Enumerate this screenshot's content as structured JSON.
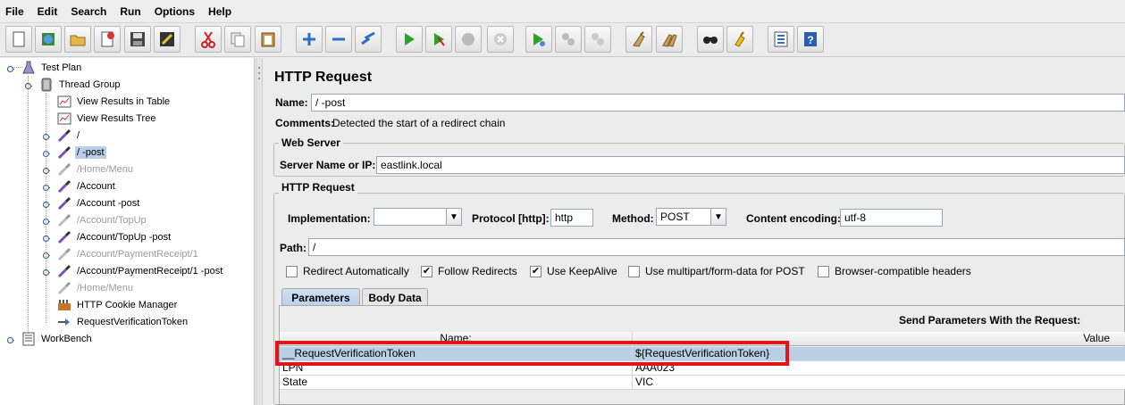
{
  "menu": [
    "File",
    "Edit",
    "Search",
    "Run",
    "Options",
    "Help"
  ],
  "toolbar": {
    "buttons": [
      "new-icon",
      "templates-icon",
      "open-icon",
      "close-icon",
      "save-icon",
      "save-as-icon",
      "cut-icon",
      "copy-icon",
      "paste-icon",
      "expand-icon",
      "collapse-icon",
      "toggle-icon",
      "start-icon",
      "start-no-pause-icon",
      "stop-icon",
      "shutdown-icon",
      "remote-start-icon",
      "remote-stop-icon",
      "remote-shutdown-icon",
      "clear-icon",
      "clear-all-icon",
      "search-icon",
      "reset-search-icon",
      "function-helper-icon",
      "help-icon"
    ]
  },
  "tree": {
    "items": [
      {
        "label": "Test Plan"
      },
      {
        "label": "Thread Group"
      },
      {
        "label": "View Results in Table"
      },
      {
        "label": "View Results Tree"
      },
      {
        "label": "/"
      },
      {
        "label": "/ -post"
      },
      {
        "label": "/Home/Menu"
      },
      {
        "label": "/Account"
      },
      {
        "label": "/Account -post"
      },
      {
        "label": "/Account/TopUp"
      },
      {
        "label": "/Account/TopUp -post"
      },
      {
        "label": "/Account/PaymentReceipt/1"
      },
      {
        "label": "/Account/PaymentReceipt/1 -post"
      },
      {
        "label": "/Home/Menu"
      },
      {
        "label": "HTTP Cookie Manager"
      },
      {
        "label": "RequestVerificationToken"
      },
      {
        "label": "WorkBench"
      }
    ]
  },
  "panel": {
    "title": "HTTP Request",
    "name_label": "Name:",
    "name_value": "/ -post",
    "comments_label": "Comments:",
    "comments_value": "Detected the start of a redirect chain",
    "web_server_legend": "Web Server",
    "server_label": "Server Name or IP:",
    "server_value": "eastlink.local",
    "http_request_legend": "HTTP Request",
    "implementation_label": "Implementation:",
    "implementation_value": "",
    "protocol_label": "Protocol [http]:",
    "protocol_value": "http",
    "method_label": "Method:",
    "method_value": "POST",
    "encoding_label": "Content encoding:",
    "encoding_value": "utf-8",
    "path_label": "Path:",
    "path_value": "/",
    "checkboxes": [
      {
        "label": "Redirect Automatically",
        "checked": false
      },
      {
        "label": "Follow Redirects",
        "checked": true
      },
      {
        "label": "Use KeepAlive",
        "checked": true
      },
      {
        "label": "Use multipart/form-data for POST",
        "checked": false
      },
      {
        "label": "Browser-compatible headers",
        "checked": false
      }
    ],
    "tabs": [
      "Parameters",
      "Body Data"
    ],
    "send_params_label": "Send Parameters With the Request:",
    "table": {
      "columns": [
        "Name:",
        "Value"
      ],
      "rows": [
        {
          "name": "__RequestVerificationToken",
          "value": "${RequestVerificationToken}"
        },
        {
          "name": "LPN",
          "value": "AAA023"
        },
        {
          "name": "State",
          "value": "VIC"
        }
      ]
    }
  }
}
